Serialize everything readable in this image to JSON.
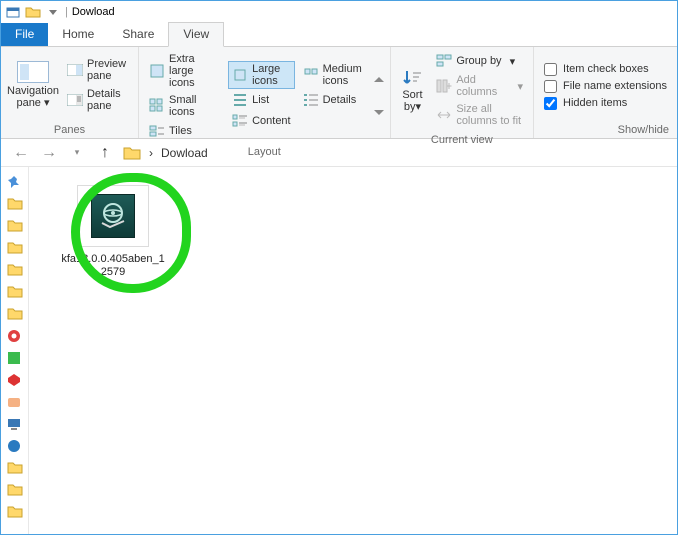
{
  "title": "Dowload",
  "tabs": {
    "file": "File",
    "home": "Home",
    "share": "Share",
    "view": "View"
  },
  "panes": {
    "nav": "Navigation\npane",
    "navArrow": "▾",
    "preview": "Preview pane",
    "details": "Details pane",
    "label": "Panes"
  },
  "layout": {
    "xl": "Extra large icons",
    "lg": "Large icons",
    "md": "Medium icons",
    "sm": "Small icons",
    "list": "List",
    "det": "Details",
    "tiles": "Tiles",
    "content": "Content",
    "label": "Layout"
  },
  "view": {
    "sort": "Sort\nby",
    "sortArrow": "▾",
    "group": "Group by",
    "groupArrow": "▾",
    "addcols": "Add columns",
    "addcolsArrow": "▾",
    "size": "Size all columns to fit",
    "label": "Current view"
  },
  "show": {
    "chk": "Item check boxes",
    "ext": "File name extensions",
    "hidden": "Hidden items",
    "label": "Show/hide"
  },
  "nav": {
    "sep": "›",
    "loc": "Dowload"
  },
  "file": {
    "name": "kfa18.0.0.405aben_12579"
  }
}
